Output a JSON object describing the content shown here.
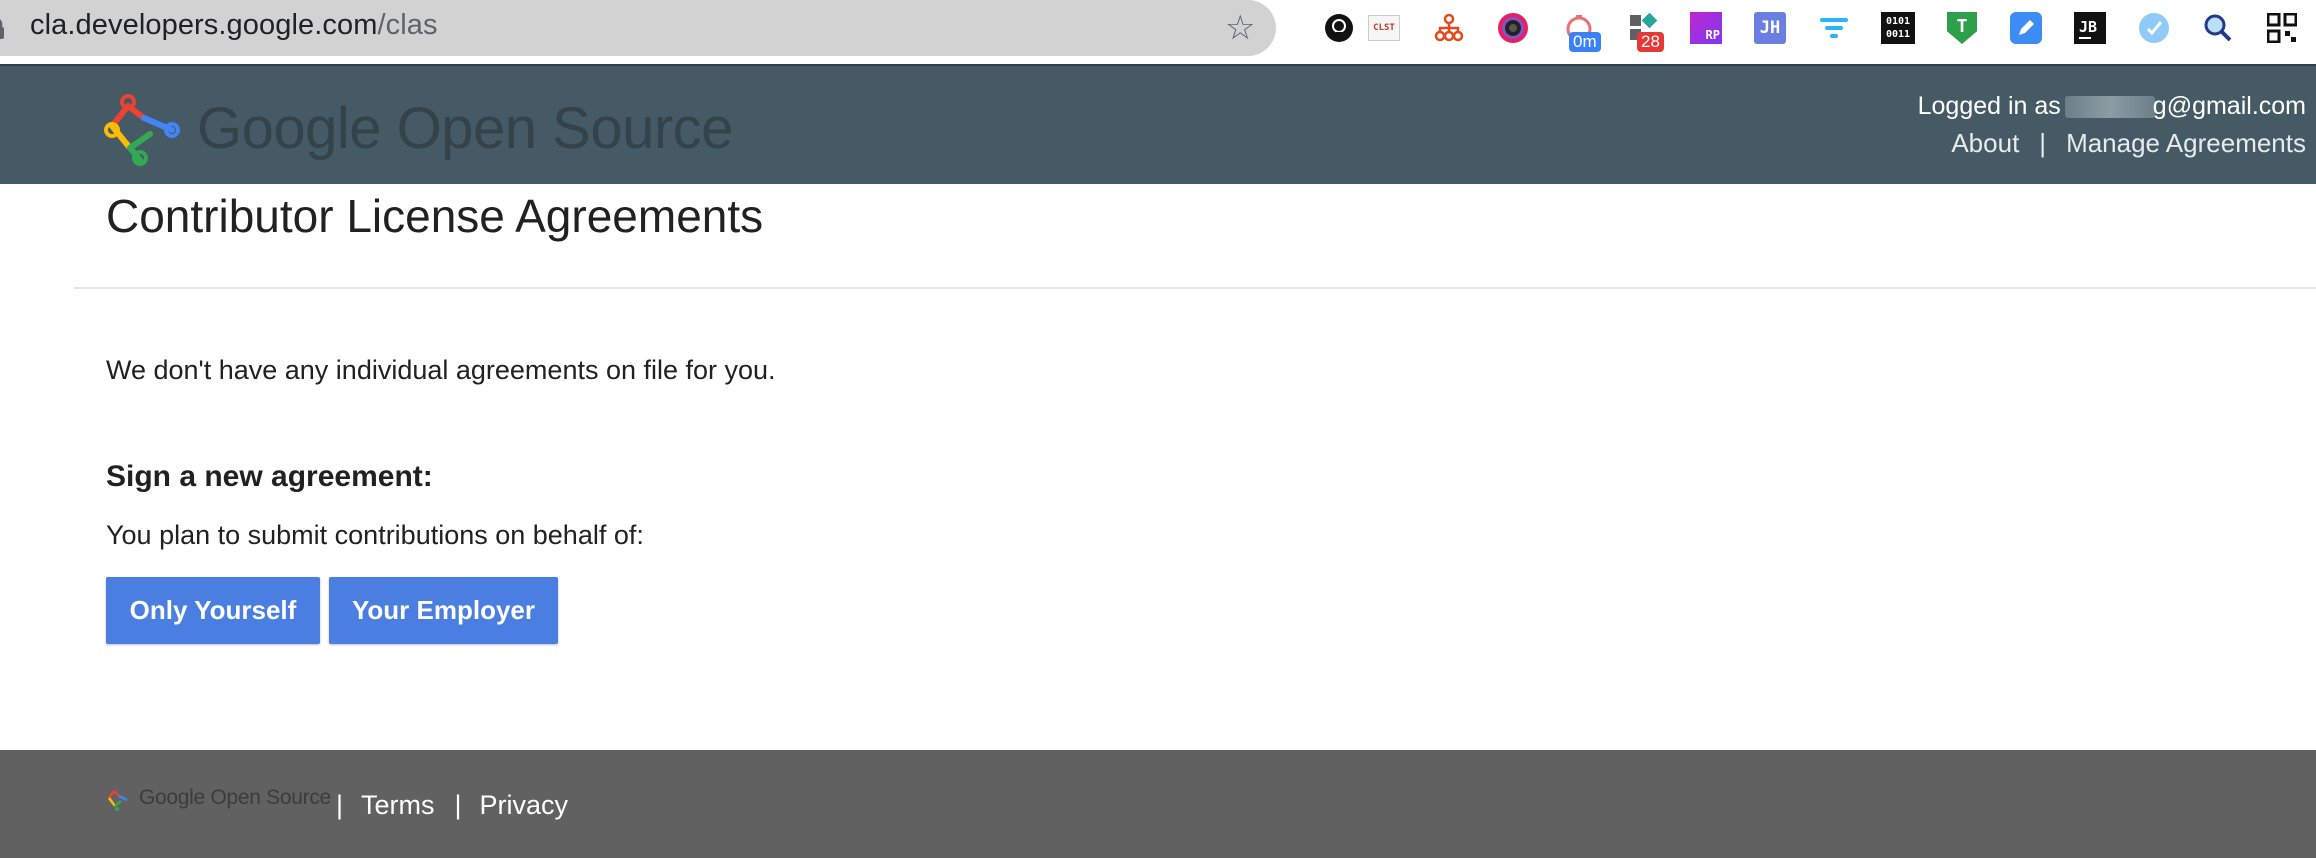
{
  "browser": {
    "url_host": "cla.developers.google.com",
    "url_path": "/clas",
    "extensions": [
      {
        "name": "github-icon",
        "text": ""
      },
      {
        "name": "clst-icon",
        "text": "CLST"
      },
      {
        "name": "sitemap-icon",
        "text": ""
      },
      {
        "name": "camera-circle-icon",
        "text": ""
      },
      {
        "name": "timer-icon",
        "badge": "0m",
        "badge_color": "#3b82f6"
      },
      {
        "name": "apps-icon",
        "badge": "28",
        "badge_color": "#e53935"
      },
      {
        "name": "rp-icon",
        "text": "RP"
      },
      {
        "name": "jh-icon",
        "text": "JH"
      },
      {
        "name": "filter-icon",
        "text": ""
      },
      {
        "name": "binary-icon",
        "text": "0101\n0011"
      },
      {
        "name": "shield-t-icon",
        "text": "T"
      },
      {
        "name": "pen-icon",
        "text": ""
      },
      {
        "name": "jb-icon",
        "text": "JB"
      },
      {
        "name": "check-circle-icon",
        "text": ""
      },
      {
        "name": "magnifier-icon",
        "text": ""
      },
      {
        "name": "qr-icon",
        "text": ""
      }
    ]
  },
  "header": {
    "logo_google": "Google",
    "logo_rest": " Open Source",
    "logged_in_prefix": "Logged in as",
    "logged_in_email_suffix": "g@gmail.com",
    "nav": [
      "About",
      "Manage Agreements"
    ]
  },
  "main": {
    "title": "Contributor License Agreements",
    "notice": "We don't have any individual agreements on file for you.",
    "subhead": "Sign a new agreement:",
    "prompt": "You plan to submit contributions on behalf of:",
    "buttons": [
      "Only Yourself",
      "Your Employer"
    ]
  },
  "footer": {
    "logo_text": "Google Open Source",
    "links": [
      "Terms",
      "Privacy"
    ]
  },
  "colors": {
    "header_bg": "#455a64",
    "button_bg": "#4a7ee0",
    "footer_bg": "#616161"
  }
}
